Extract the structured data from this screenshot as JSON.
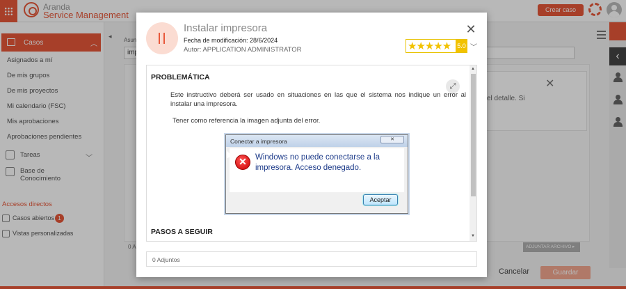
{
  "app": {
    "brand_top": "Aranda",
    "brand_bottom": "Service Management",
    "create_case_label": "Crear caso"
  },
  "sidebar": {
    "casos_label": "Casos",
    "items": [
      "Asignados a mí",
      "De mis grupos",
      "De mis proyectos",
      "Mi calendario (FSC)",
      "Mis aprobaciones",
      "Aprobaciones pendientes"
    ],
    "tareas_label": "Tareas",
    "base_label_1": "Base de",
    "base_label_2": "Conocimiento",
    "accesos_label": "Accesos directos",
    "casos_abiertos_label": "Casos abiertos",
    "casos_abiertos_count": "1",
    "vistas_label": "Vistas personalizadas"
  },
  "main": {
    "field_label": "Asun",
    "field_value": "imp",
    "card_text_1": "el detalle. Si",
    "bottom_label": "0 A",
    "adjuntar_label": "ADJUNTAR ARCHIVO ▸",
    "cancel_label": "Cancelar",
    "save_label": "Guardar"
  },
  "modal": {
    "title": "Instalar impresora",
    "date": "Fecha de modificación: 28/6/2024",
    "author": "Autor: APPLICATION ADMINISTRATOR",
    "stars": "★★★★★",
    "score": "5.0",
    "section_problem": "PROBLEMÁTICA",
    "paragraph_1": "Este instructivo deberá ser usado en situaciones en las que el sistema nos indique un error al instalar una impresora.",
    "paragraph_2": "Tener como referencia la imagen adjunta del error.",
    "section_steps": "PASOS A SEGUIR",
    "attachments": "0 Adjuntos"
  },
  "error_dialog": {
    "title": "Conectar a impresora",
    "message": "Windows no puede conectarse a la impresora. Acceso denegado.",
    "button": "Aceptar"
  },
  "colors": {
    "accent": "#e8583a",
    "rating": "#f2c200"
  }
}
